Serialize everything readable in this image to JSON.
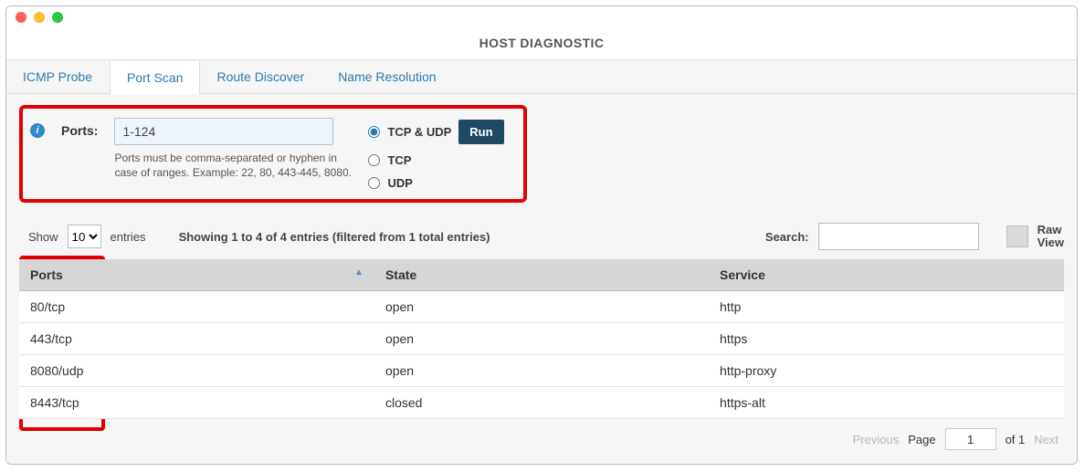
{
  "window": {
    "title": "HOST DIAGNOSTIC"
  },
  "tabs": [
    {
      "id": "icmp",
      "label": "ICMP Probe"
    },
    {
      "id": "ports",
      "label": "Port Scan"
    },
    {
      "id": "route",
      "label": "Route Discover"
    },
    {
      "id": "name",
      "label": "Name Resolution"
    }
  ],
  "active_tab": "ports",
  "config": {
    "ports_label": "Ports:",
    "ports_value": "1-124",
    "hint": "Ports must be comma-separated or hyphen in case of ranges. Example: 22, 80, 443-445, 8080.",
    "proto_options": [
      {
        "id": "both",
        "label": "TCP & UDP",
        "checked": true
      },
      {
        "id": "tcp",
        "label": "TCP",
        "checked": false
      },
      {
        "id": "udp",
        "label": "UDP",
        "checked": false
      }
    ],
    "run_label": "Run"
  },
  "list_controls": {
    "show_label_pre": "Show",
    "show_value": "10",
    "show_label_post": "entries",
    "summary": "Showing 1 to 4 of 4 entries (filtered from 1 total entries)",
    "search_label": "Search:",
    "search_value": "",
    "raw_view_label": "Raw View"
  },
  "table": {
    "columns": [
      "Ports",
      "State",
      "Service"
    ],
    "sort_col": 0,
    "sort_dir": "asc",
    "rows": [
      {
        "port": "80/tcp",
        "state": "open",
        "service": "http"
      },
      {
        "port": "443/tcp",
        "state": "open",
        "service": "https"
      },
      {
        "port": "8080/udp",
        "state": "open",
        "service": "http-proxy"
      },
      {
        "port": "8443/tcp",
        "state": "closed",
        "service": "https-alt"
      }
    ]
  },
  "pager": {
    "prev_label": "Previous",
    "page_label": "Page",
    "page_value": "1",
    "of_label": "of 1",
    "next_label": "Next"
  }
}
